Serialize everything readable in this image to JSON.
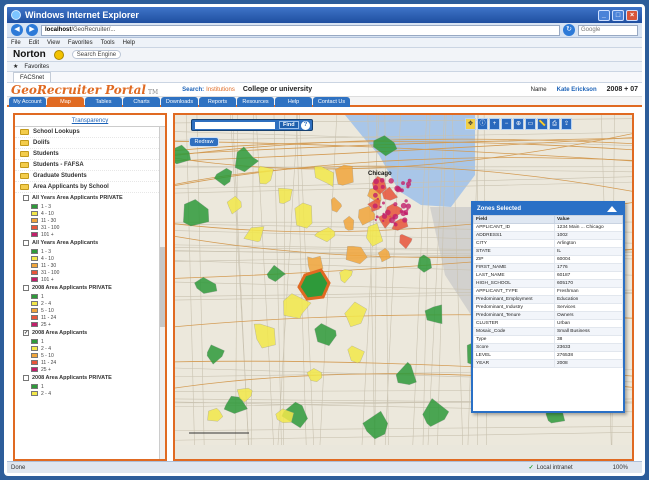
{
  "window": {
    "title": "Windows Internet Explorer"
  },
  "addressbar": {
    "host": "localhost",
    "path": "/GeoRecruiter/...",
    "search_placeholder": "Google"
  },
  "menubar": {
    "items": [
      "File",
      "Edit",
      "View",
      "Favorites",
      "Tools",
      "Help"
    ]
  },
  "norton": {
    "brand": "Norton",
    "search_placeholder": "Search Engine"
  },
  "favbar": {
    "label": "Favorites"
  },
  "tabbar": {
    "tab": "FACSnet"
  },
  "app": {
    "logo": "GeoRecruiter Portal",
    "logo_suffix": "TM",
    "search_label": "Search:",
    "search_type": "Institutions",
    "search_value": "College or university",
    "user_label": "Name",
    "user": "Kate Erickson",
    "year": "2008 + 07",
    "nav_tabs": [
      "My Account",
      "Map",
      "Tables",
      "Charts",
      "Downloads",
      "Reports",
      "Resources",
      "Help",
      "Contact Us"
    ],
    "active_tab": 1
  },
  "sidebar": {
    "header": "Transparency",
    "folders": [
      "School Lookups",
      "Dolifs",
      "Students",
      "Students - FAFSA",
      "Graduate Students",
      "Area Applicants by School"
    ],
    "layers": [
      {
        "label": "All Years Area Applicants PRIVATE",
        "checked": false,
        "legend": [
          "1 - 3",
          "4 - 10",
          "11 - 30",
          "31 - 100",
          "101 +"
        ]
      },
      {
        "label": "All Years Area Applicants",
        "checked": false,
        "legend": [
          "1 - 3",
          "4 - 10",
          "11 - 30",
          "31 - 100",
          "101 +"
        ]
      },
      {
        "label": "2008 Area Applicants PRIVATE",
        "checked": false,
        "legend": [
          "1",
          "2 - 4",
          "5 - 10",
          "11 - 24",
          "25 +"
        ]
      },
      {
        "label": "2008 Area Applicants",
        "checked": true,
        "legend": [
          "1",
          "2 - 4",
          "5 - 10",
          "11 - 24",
          "25 +"
        ]
      },
      {
        "label": "2008 Area Applicants PRIVATE",
        "checked": false,
        "legend": [
          "1",
          "2 - 4"
        ]
      }
    ],
    "legend_colors": [
      "#2e9a3a",
      "#f3e84a",
      "#f1a63c",
      "#e8553a",
      "#c21f6b"
    ]
  },
  "map": {
    "search_button": "Find",
    "help_icon": "?",
    "redraw_button": "Redraw",
    "city_label": "Chicago",
    "tools": [
      "pan-icon",
      "identify-icon",
      "zoom-in-icon",
      "zoom-out-icon",
      "full-extent-icon",
      "select-icon",
      "measure-icon",
      "print-icon",
      "export-icon"
    ]
  },
  "infowindow": {
    "title": "Zones Selected",
    "columns": [
      "Field",
      "Value"
    ],
    "rows": [
      [
        "APPLICANT_ID",
        "1234 Main ... Chicago"
      ],
      [
        "ADDRESS1",
        "1002"
      ],
      [
        "CITY",
        "Arlington"
      ],
      [
        "STATE",
        "IL"
      ],
      [
        "ZIP",
        "60004"
      ],
      [
        "FIRST_NAME",
        "1776"
      ],
      [
        "LAST_NAME",
        "60187"
      ],
      [
        "HIGH_SCHOOL",
        "605170"
      ],
      [
        "APPLICANT_TYPE",
        "Freshman"
      ],
      [
        "Predominant_Employment",
        "Education"
      ],
      [
        "Predominant_Industry",
        "Services"
      ],
      [
        "Predominant_Tenure",
        "Owners"
      ],
      [
        "CLUSTER",
        "Urban"
      ],
      [
        "Mosaic_Code",
        "Small Business"
      ],
      [
        "Type",
        "38"
      ],
      [
        "Score",
        "23633"
      ],
      [
        "LEVEL",
        "276538"
      ],
      [
        "YEAR",
        "2008"
      ]
    ]
  },
  "statusbar": {
    "left": "Done",
    "zone": "Local intranet",
    "zoom": "100%"
  }
}
